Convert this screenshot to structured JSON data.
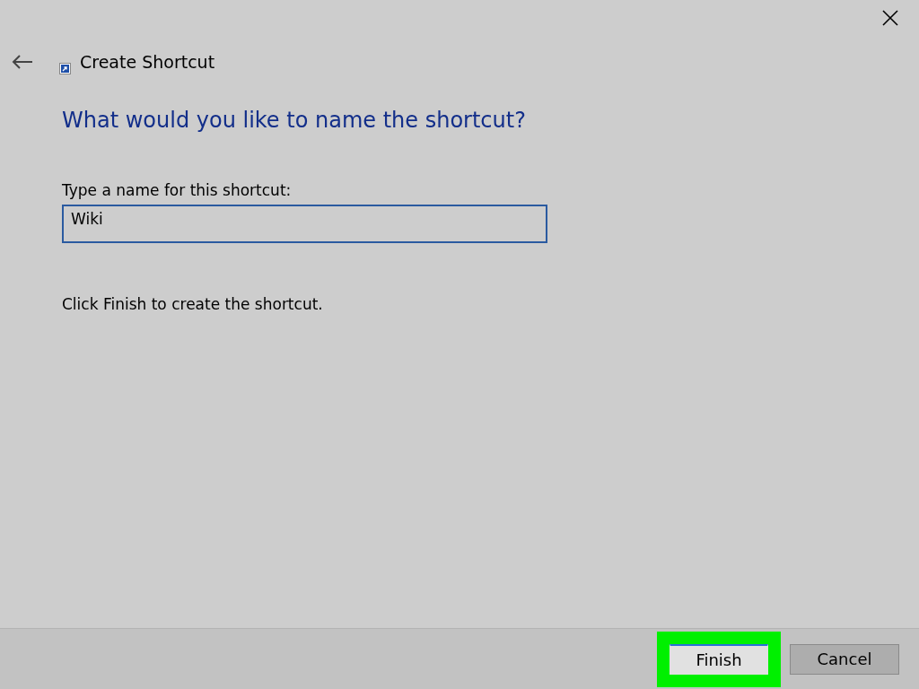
{
  "window": {
    "title": "Create Shortcut"
  },
  "heading": "What would you like to name the shortcut?",
  "name_field": {
    "label": "Type a name for this shortcut:",
    "value": "Wiki"
  },
  "instruction": "Click Finish to create the shortcut.",
  "buttons": [
    {
      "label": "Finish",
      "default": true,
      "highlighted": true
    },
    {
      "label": "Cancel",
      "default": false,
      "highlighted": false
    }
  ]
}
